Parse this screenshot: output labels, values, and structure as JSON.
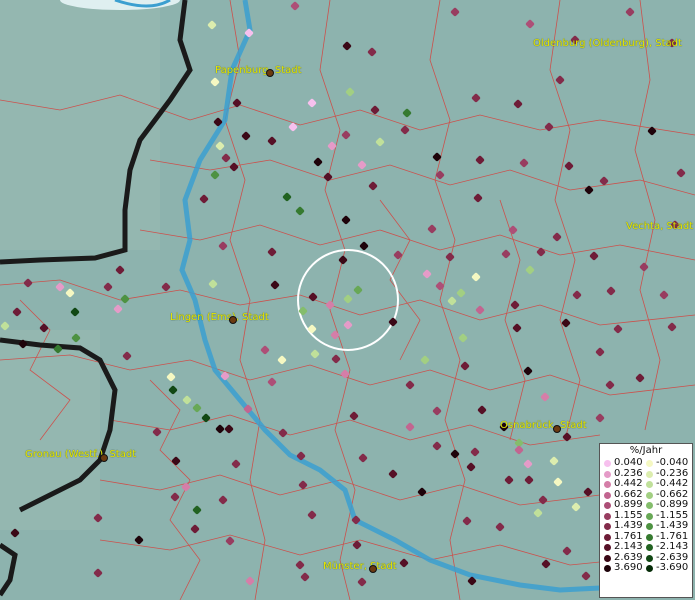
{
  "cities": [
    {
      "name": "Oldenburg (Oldenburg), Stadt"
    },
    {
      "name": "Papenburg, Stadt"
    },
    {
      "name": "Vechta, Stadt"
    },
    {
      "name": "Lingen (Ems), Stadt"
    },
    {
      "name": "Osnabrück, Stadt"
    },
    {
      "name": "Gronau (Westf.), Stadt"
    },
    {
      "name": "Münster, Stadt"
    }
  ],
  "legend": {
    "title": "%/Jahr",
    "positive": [
      {
        "value": "0.040",
        "color": "#f7c0ee"
      },
      {
        "value": "0.236",
        "color": "#e59bc8"
      },
      {
        "value": "0.442",
        "color": "#d57ea8"
      },
      {
        "value": "0.662",
        "color": "#c26590"
      },
      {
        "value": "0.899",
        "color": "#ad4f77"
      },
      {
        "value": "1.155",
        "color": "#983d60"
      },
      {
        "value": "1.439",
        "color": "#832b4a"
      },
      {
        "value": "1.761",
        "color": "#6e1c37"
      },
      {
        "value": "2.143",
        "color": "#561026"
      },
      {
        "value": "2.639",
        "color": "#3b0816"
      },
      {
        "value": "3.690",
        "color": "#1e030a"
      }
    ],
    "negative": [
      {
        "value": "-0.040",
        "color": "#f5f8c2"
      },
      {
        "value": "-0.236",
        "color": "#dcedae"
      },
      {
        "value": "-0.442",
        "color": "#c0e09a"
      },
      {
        "value": "-0.662",
        "color": "#a2cf82"
      },
      {
        "value": "-0.899",
        "color": "#84bd6c"
      },
      {
        "value": "-1.155",
        "color": "#68a856"
      },
      {
        "value": "-1.439",
        "color": "#4e9242"
      },
      {
        "value": "-1.761",
        "color": "#367a30"
      },
      {
        "value": "-2.143",
        "color": "#226221"
      },
      {
        "value": "-2.639",
        "color": "#114814"
      },
      {
        "value": "-3.690",
        "color": "#052c07"
      }
    ]
  }
}
